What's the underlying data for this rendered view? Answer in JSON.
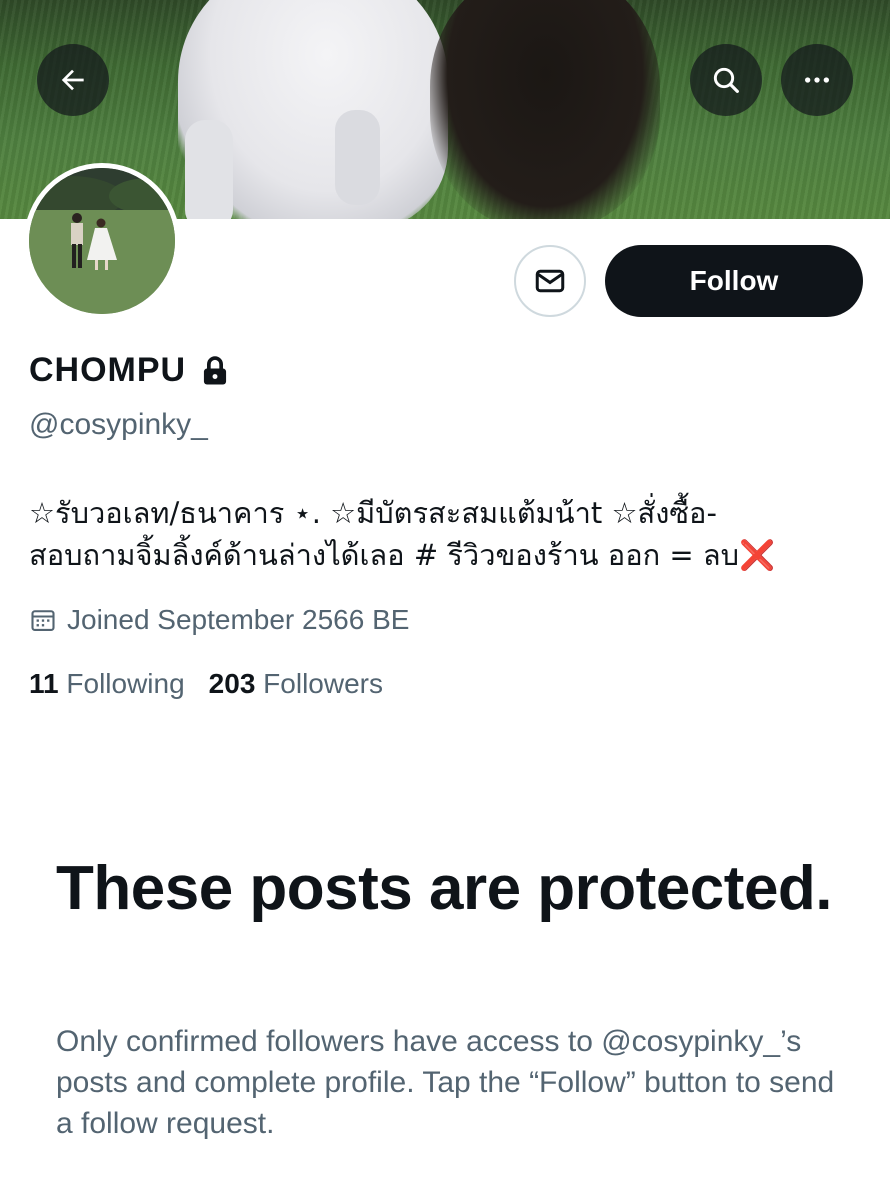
{
  "profile": {
    "display_name": "CHOMPU",
    "handle": "@cosypinky_",
    "bio_line1": "☆รับวอเลท/ธนาคาร ⋆. ☆มีบัตรสะสมแต้มน้าt ☆สั่งซื้อ-",
    "bio_line2": "สอบถามจิ้มลิ้งค์ด้านล่างได้เลอ # รีวิวของร้าน ออก = ลบ",
    "bio_emoji": "❌",
    "joined": "Joined September 2566 BE",
    "following_count": "11",
    "following_label": "Following",
    "followers_count": "203",
    "followers_label": "Followers",
    "locked": true
  },
  "actions": {
    "follow_label": "Follow"
  },
  "protected": {
    "title": "These posts are protected.",
    "text": "Only confirmed followers have access to @cosypinky_’s posts and complete profile. Tap the “Follow” button to send a follow request."
  },
  "icons": {
    "back": "back-arrow-icon",
    "search": "search-icon",
    "more": "more-icon",
    "message": "message-icon",
    "lock": "lock-icon",
    "calendar": "calendar-icon"
  },
  "colors": {
    "primary_text": "#0f1419",
    "secondary_text": "#536471",
    "follow_button": "#0f1419",
    "border": "#cfd9de",
    "x_mark": "#e0282e"
  }
}
